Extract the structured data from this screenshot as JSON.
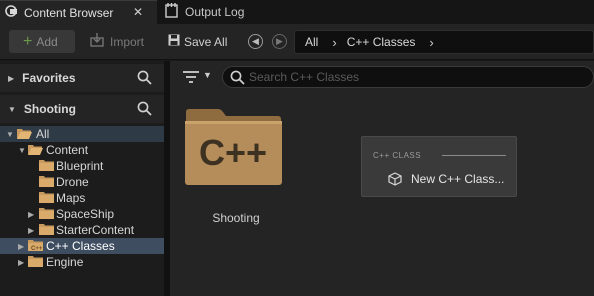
{
  "tabs": {
    "content_browser": "Content Browser",
    "close_glyph": "✕",
    "output_log": "Output Log"
  },
  "toolbar": {
    "add_label": "Add",
    "import_label": "Import",
    "save_all_label": "Save All"
  },
  "path": {
    "crumbs": [
      "All",
      "C++ Classes"
    ]
  },
  "sidebar": {
    "favorites_label": "Favorites",
    "project_label": "Shooting",
    "tree": [
      {
        "label": "All"
      },
      {
        "label": "Content"
      },
      {
        "label": "Blueprint"
      },
      {
        "label": "Drone"
      },
      {
        "label": "Maps"
      },
      {
        "label": "SpaceShip"
      },
      {
        "label": "StarterContent"
      },
      {
        "label": "C++ Classes"
      },
      {
        "label": "Engine"
      }
    ]
  },
  "main": {
    "search_placeholder": "Search C++ Classes",
    "folder_name": "Shooting",
    "folder_glyph": "C++"
  },
  "popup": {
    "heading": "C++ CLASS",
    "item_label": "New C++ Class..."
  },
  "colors": {
    "folder": "#b48d5a",
    "selection": "#3e4d60",
    "add_plus": "#6a9a4a"
  }
}
